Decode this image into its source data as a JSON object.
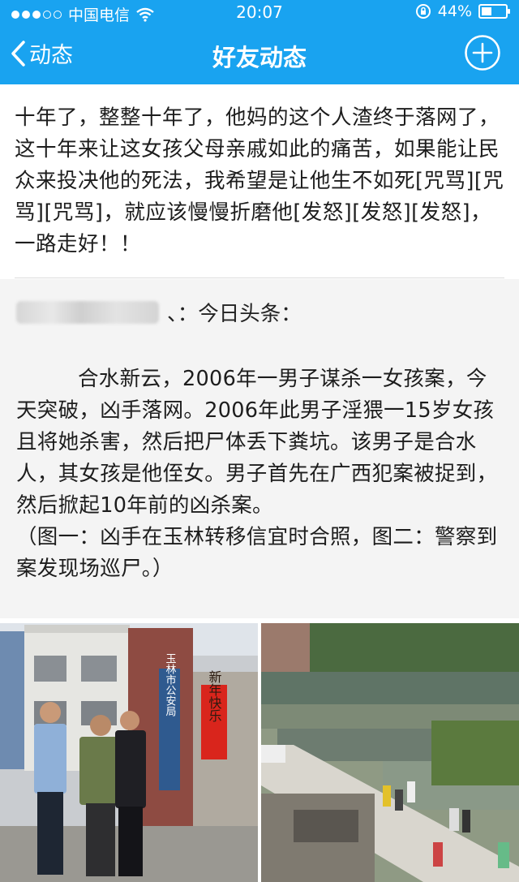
{
  "status_bar": {
    "carrier": "中国电信",
    "time": "20:07",
    "battery_text": "44%",
    "battery_level": 0.44,
    "icons": [
      "signal-dots-icon",
      "wifi-icon",
      "rotation-lock-icon",
      "battery-icon"
    ]
  },
  "nav": {
    "back_label": "动态",
    "title": "好友动态",
    "back_icon": "chevron-left-icon",
    "add_icon": "plus-circle-icon"
  },
  "post": {
    "text": "十年了，整整十年了，他妈的这个人渣终于落网了，这十年来让这女孩父母亲戚如此的痛苦，如果能让民众来投决他的死法，我希望是让他生不如死[咒骂][咒骂][咒骂]，就应该慢慢折磨他[发怒][发怒][发怒]，一路走好！！"
  },
  "share": {
    "source_suffix": "、：今日头条：",
    "paragraph1": "合水新云，2006年一男子谋杀一女孩案，今天突破，凶手落网。2006年此男子淫猥一15岁女孩且将她杀害，然后把尸体丢下粪坑。该男子是合水人，其女孩是他侄女。男子首先在广西犯案被捉到，然后掀起10年前的凶杀案。",
    "paragraph2": "（图一：凶手在玉林转移信宜时合照，图二：警察到案发现场巡尸。）"
  },
  "photos": {
    "photo1_sign": "玉林市公安局",
    "photo1_couplet": "新年快乐"
  },
  "colors": {
    "header_blue": "#19a3f0",
    "share_bg": "#f4f4f4"
  }
}
